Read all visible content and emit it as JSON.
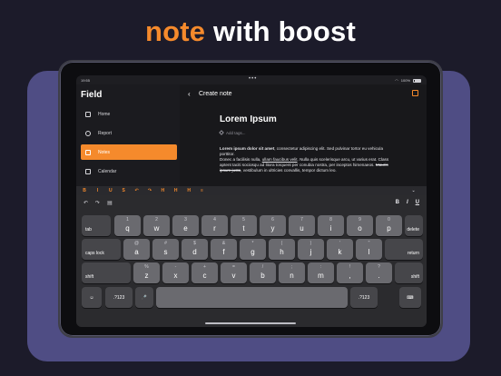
{
  "headline": {
    "accent": "note",
    "rest": " with boost"
  },
  "colors": {
    "accent": "#f58a2c",
    "backdrop": "#4f4d84",
    "background": "#1c1b2a"
  },
  "statusbar": {
    "time": "19:55",
    "battery": "100%"
  },
  "sidebar": {
    "title": "Field",
    "items": [
      {
        "label": "Home",
        "icon": "home-icon",
        "active": false
      },
      {
        "label": "Report",
        "icon": "clock-icon",
        "active": false
      },
      {
        "label": "Notes",
        "icon": "note-icon",
        "active": true
      },
      {
        "label": "Calendar",
        "icon": "calendar-icon",
        "active": false
      }
    ]
  },
  "main": {
    "header": "Create note",
    "note_title": "Lorem Ipsum",
    "tags_placeholder": "Add tags...",
    "body": {
      "bold": "Lorem ipsum dolor sit amet",
      "p1": ", consectetur adipiscing elit. Sed pulvinar tortor eu vehicula porttitor.",
      "p2a": "Donec a facilisis nulla, ",
      "p2u": "ullam faucibus velit",
      "p2b": ". Nulla quis scelerisque arcu, ut varius erat. Class aptent taciti sociosqu ad litora torquent per conubia nostra, per inceptos himenaeos. ",
      "p2s": "Mauris ipsum justo",
      "p2c": ", vestibulum in ultricies convallis, tempor dictum leo."
    }
  },
  "format_toolbar": [
    "B",
    "I",
    "U",
    "S",
    "↶",
    "↷",
    "H",
    "H",
    "H",
    "≡"
  ],
  "keyboard": {
    "tools_right": [
      "B",
      "I",
      "U"
    ],
    "rows": [
      [
        {
          "label": "tab",
          "dark": true
        },
        {
          "sub": "1",
          "label": "q"
        },
        {
          "sub": "2",
          "label": "w"
        },
        {
          "sub": "3",
          "label": "e"
        },
        {
          "sub": "4",
          "label": "r"
        },
        {
          "sub": "5",
          "label": "t"
        },
        {
          "sub": "6",
          "label": "y"
        },
        {
          "sub": "7",
          "label": "u"
        },
        {
          "sub": "8",
          "label": "i"
        },
        {
          "sub": "9",
          "label": "o"
        },
        {
          "sub": "0",
          "label": "p"
        },
        {
          "label": "delete",
          "dark": true
        }
      ],
      [
        {
          "label": "caps lock",
          "dark": true
        },
        {
          "sub": "@",
          "label": "a"
        },
        {
          "sub": "#",
          "label": "s"
        },
        {
          "sub": "$",
          "label": "d"
        },
        {
          "sub": "&",
          "label": "f"
        },
        {
          "sub": "*",
          "label": "g"
        },
        {
          "sub": "(",
          "label": "h"
        },
        {
          "sub": ")",
          "label": "j"
        },
        {
          "sub": "'",
          "label": "k"
        },
        {
          "sub": "\"",
          "label": "l"
        },
        {
          "label": "return",
          "dark": true
        }
      ],
      [
        {
          "label": "shift",
          "dark": true
        },
        {
          "sub": "%",
          "label": "z"
        },
        {
          "sub": "-",
          "label": "x"
        },
        {
          "sub": "+",
          "label": "c"
        },
        {
          "sub": "=",
          "label": "v"
        },
        {
          "sub": "/",
          "label": "b"
        },
        {
          "sub": ";",
          "label": "n"
        },
        {
          "sub": ":",
          "label": "m"
        },
        {
          "sub": "!",
          "label": ","
        },
        {
          "sub": "?",
          "label": "."
        },
        {
          "label": "shift",
          "dark": true
        }
      ],
      [
        {
          "label": "☺",
          "dark": true
        },
        {
          "label": ".?123",
          "dark": true
        },
        {
          "label": "🎤",
          "dark": true
        },
        {
          "label": "",
          "dark": false
        },
        {
          "label": ".?123",
          "dark": true
        },
        {
          "label": "⌨",
          "dark": true
        }
      ]
    ]
  }
}
